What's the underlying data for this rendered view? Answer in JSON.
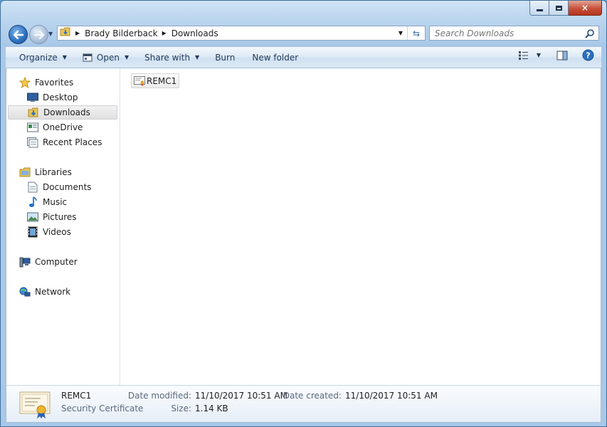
{
  "window": {
    "caption": {
      "minimize": "minimize",
      "maximize": "maximize",
      "close": "×"
    }
  },
  "address": {
    "crumbs": [
      "Brady Bilderback",
      "Downloads"
    ]
  },
  "search": {
    "placeholder": "Search Downloads"
  },
  "toolbar": {
    "organize": "Organize",
    "open": "Open",
    "share_with": "Share with",
    "burn": "Burn",
    "new_folder": "New folder"
  },
  "nav": {
    "favorites": "Favorites",
    "desktop": "Desktop",
    "downloads": "Downloads",
    "onedrive": "OneDrive",
    "recent_places": "Recent Places",
    "libraries": "Libraries",
    "documents": "Documents",
    "music": "Music",
    "pictures": "Pictures",
    "videos": "Videos",
    "computer": "Computer",
    "network": "Network"
  },
  "files": [
    {
      "name": "REMC1",
      "icon": "certificate-icon"
    }
  ],
  "details": {
    "name": "REMC1",
    "type": "Security Certificate",
    "modified_label": "Date modified:",
    "modified_value": "11/10/2017 10:51 AM",
    "created_label": "Date created:",
    "created_value": "11/10/2017 10:51 AM",
    "size_label": "Size:",
    "size_value": "1.14 KB"
  },
  "colors": {
    "accent": "#2c6fbf",
    "frame": "#a9c8e8",
    "selection": "#e0e0e0"
  }
}
